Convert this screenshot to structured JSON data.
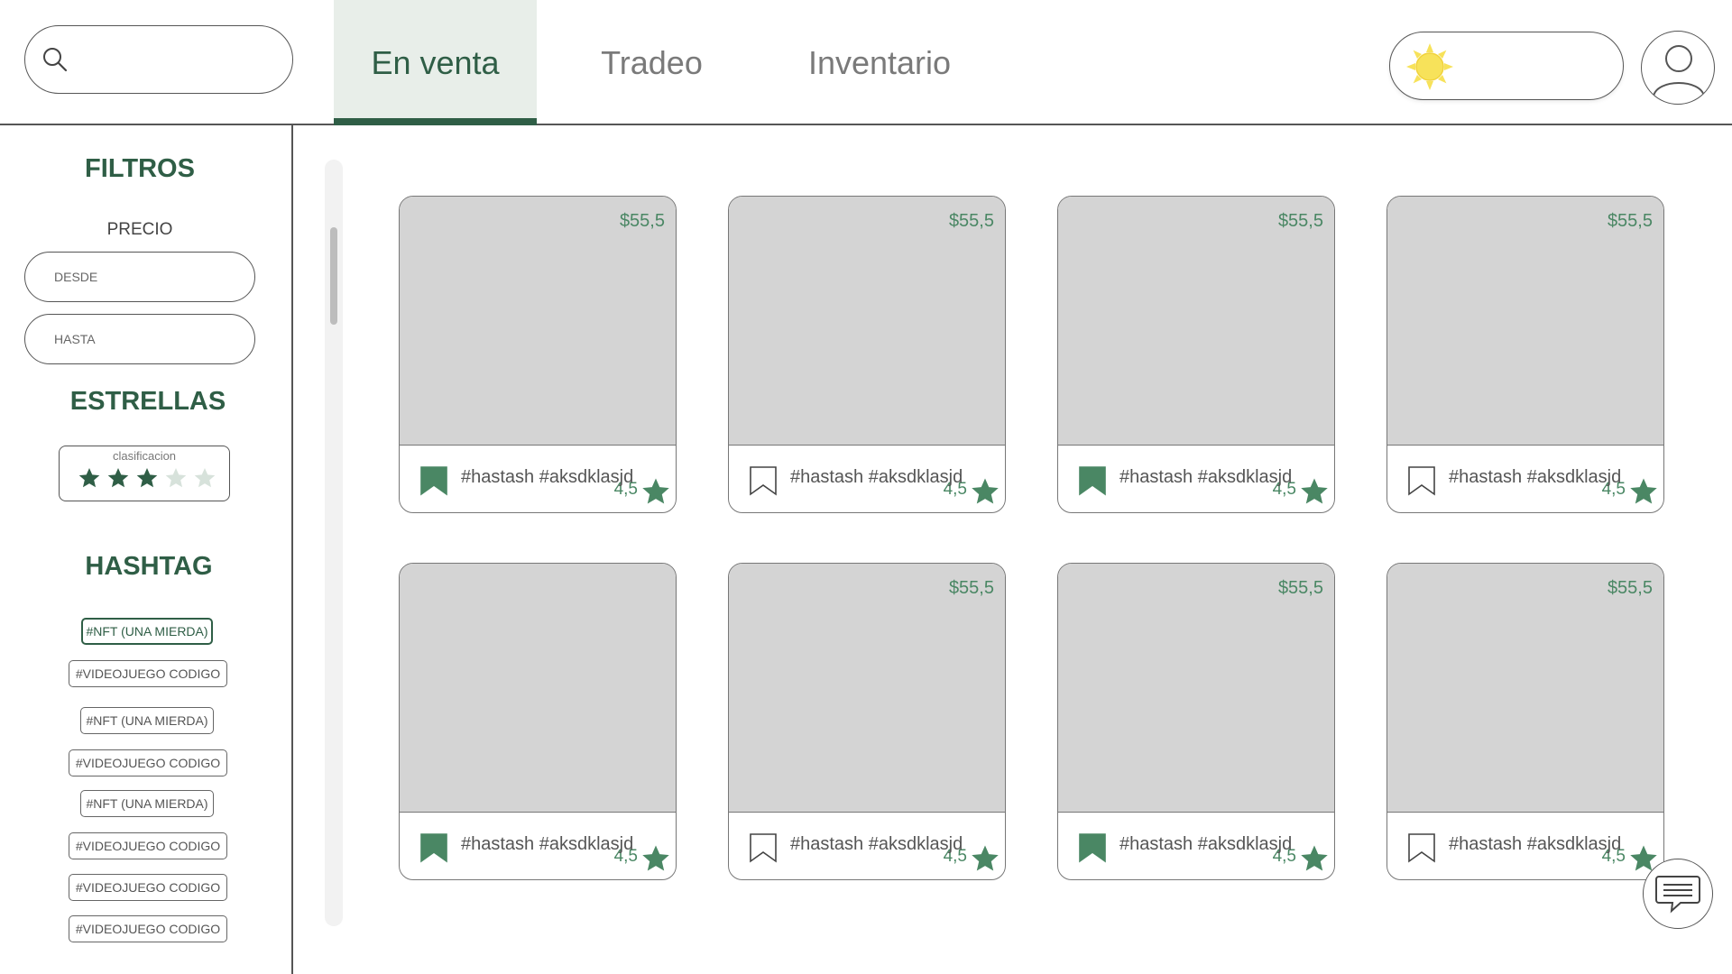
{
  "header": {
    "search": {
      "placeholder": "",
      "value": ""
    },
    "tabs": [
      {
        "label": "En venta",
        "active": true
      },
      {
        "label": "Tradeo",
        "active": false
      },
      {
        "label": "Inventario",
        "active": false
      }
    ],
    "theme_icon": "sun-icon",
    "profile_icon": "user-icon"
  },
  "sidebar": {
    "filters_title": "FILTROS",
    "price_label": "PRECIO",
    "price_from_placeholder": "DESDE",
    "price_to_placeholder": "HASTA",
    "stars_title": "ESTRELLAS",
    "rating_caption": "clasificacion",
    "rating_value": 3,
    "rating_max": 5,
    "hashtag_title": "HASHTAG",
    "hashtags": [
      {
        "label": "#NFT (UNA MIERDA)",
        "selected": true
      },
      {
        "label": "#VIDEOJUEGO CODIGO",
        "selected": false
      },
      {
        "label": "#NFT (UNA MIERDA)",
        "selected": false
      },
      {
        "label": "#VIDEOJUEGO CODIGO",
        "selected": false
      },
      {
        "label": "#NFT (UNA MIERDA)",
        "selected": false
      },
      {
        "label": "#VIDEOJUEGO CODIGO",
        "selected": false
      },
      {
        "label": "#VIDEOJUEGO CODIGO",
        "selected": false
      },
      {
        "label": "#VIDEOJUEGO CODIGO",
        "selected": false
      }
    ]
  },
  "products": [
    {
      "price": "$55,5",
      "rating": "4,5",
      "tags": "#hastash #aksdklasjd",
      "bookmarked": true
    },
    {
      "price": "$55,5",
      "rating": "4,5",
      "tags": "#hastash #aksdklasjd",
      "bookmarked": false
    },
    {
      "price": "$55,5",
      "rating": "4,5",
      "tags": "#hastash #aksdklasjd",
      "bookmarked": true
    },
    {
      "price": "$55,5",
      "rating": "4,5",
      "tags": "#hastash #aksdklasjd",
      "bookmarked": false
    },
    {
      "price": "",
      "rating": "4,5",
      "tags": "#hastash #aksdklasjd",
      "bookmarked": true
    },
    {
      "price": "$55,5",
      "rating": "4,5",
      "tags": "#hastash #aksdklasjd",
      "bookmarked": false
    },
    {
      "price": "$55,5",
      "rating": "4,5",
      "tags": "#hastash #aksdklasjd",
      "bookmarked": true
    },
    {
      "price": "$55,5",
      "rating": "4,5",
      "tags": "#hastash #aksdklasjd",
      "bookmarked": false
    }
  ],
  "colors": {
    "accent": "#2f5e46",
    "accent_light": "#4a8764",
    "active_tab_bg": "#e8eee9",
    "card_image": "#d4d4d4",
    "sun": "#f7e25a",
    "star_empty": "#d7e2db"
  },
  "chat_icon": "chat-bubble-icon"
}
